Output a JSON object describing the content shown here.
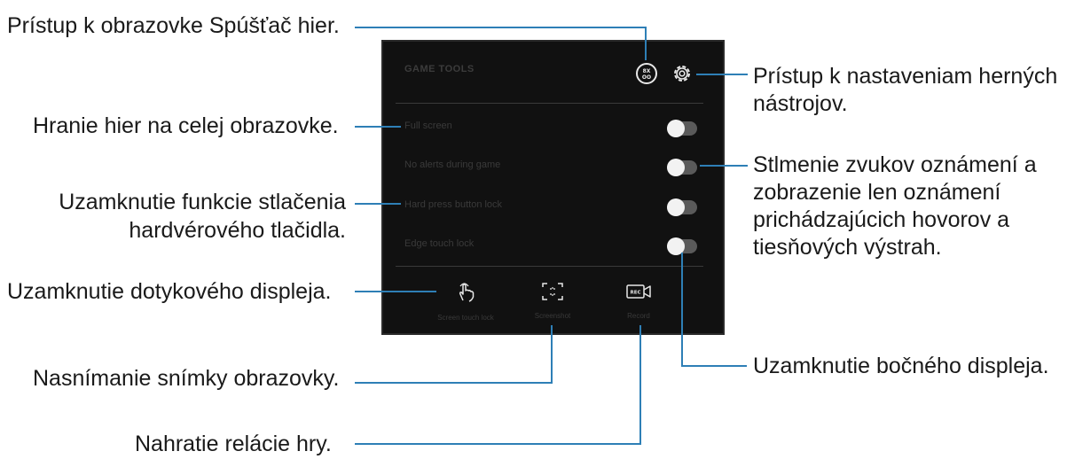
{
  "callouts": {
    "game_launcher": "Prístup k obrazovke Spúšťač hier.",
    "settings_1": "Prístup k nastaveniam herných",
    "settings_2": "nástrojov.",
    "full_screen": "Hranie hier na celej obrazovke.",
    "no_alerts_1": "Stlmenie zvukov oznámení a",
    "no_alerts_2": "zobrazenie len oznámení",
    "no_alerts_3": "prichádzajúcich hovorov a",
    "no_alerts_4": "tiesňových výstrah.",
    "hard_press_1": "Uzamknutie funkcie stlačenia",
    "hard_press_2": "hardvérového tlačidla.",
    "screen_touch": "Uzamknutie dotykového displeja.",
    "screenshot": "Nasnímanie snímky obrazovky.",
    "edge_touch": "Uzamknutie bočného displeja.",
    "record": "Nahratie relácie hry."
  },
  "panel": {
    "title": "GAME TOOLS",
    "launcher_icon_text": "8X\nOO",
    "rows": [
      {
        "label": "Full screen",
        "on": false
      },
      {
        "label": "No alerts during game",
        "on": false
      },
      {
        "label": "Hard press button lock",
        "on": false
      },
      {
        "label": "Edge touch lock",
        "on": false
      }
    ],
    "tools": [
      {
        "label": "Screen touch lock",
        "icon": "touch-hand-icon"
      },
      {
        "label": "Screenshot",
        "icon": "screenshot-icon"
      },
      {
        "label": "Record",
        "icon": "rec-camera-icon"
      }
    ]
  },
  "colors": {
    "leader_line": "#2e7fb6",
    "panel_bg": "#111111",
    "text": "#1a1a1a"
  }
}
